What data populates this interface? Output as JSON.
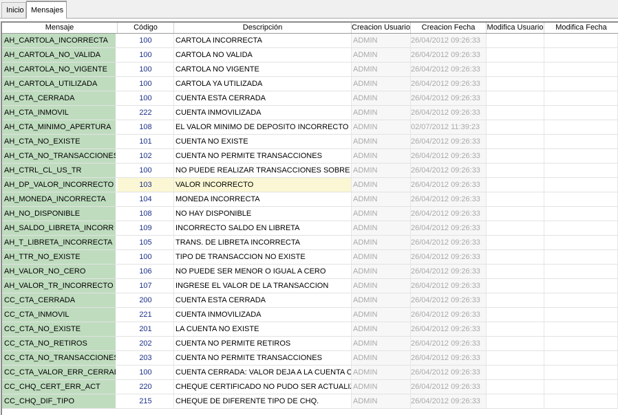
{
  "tabs": [
    {
      "label": "Inicio"
    },
    {
      "label": "Mensajes"
    }
  ],
  "grid": {
    "columns": [
      "Mensaje",
      "Código",
      "Descripción",
      "Creacion Usuario",
      "Creacion Fecha",
      "Modifica Usuario",
      "Modifica Fecha"
    ],
    "rows": [
      {
        "mensaje": "AH_CARTOLA_INCORRECTA",
        "codigo": "100",
        "descripcion": "CARTOLA INCORRECTA",
        "creacion_usuario": "ADMIN",
        "creacion_fecha": "26/04/2012 09:26:33",
        "modifica_usuario": "",
        "modifica_fecha": ""
      },
      {
        "mensaje": "AH_CARTOLA_NO_VALIDA",
        "codigo": "100",
        "descripcion": "CARTOLA NO VALIDA",
        "creacion_usuario": "ADMIN",
        "creacion_fecha": "26/04/2012 09:26:33",
        "modifica_usuario": "",
        "modifica_fecha": ""
      },
      {
        "mensaje": "AH_CARTOLA_NO_VIGENTE",
        "codigo": "100",
        "descripcion": "CARTOLA NO VIGENTE",
        "creacion_usuario": "ADMIN",
        "creacion_fecha": "26/04/2012 09:26:33",
        "modifica_usuario": "",
        "modifica_fecha": ""
      },
      {
        "mensaje": "AH_CARTOLA_UTILIZADA",
        "codigo": "100",
        "descripcion": "CARTOLA YA UTILIZADA",
        "creacion_usuario": "ADMIN",
        "creacion_fecha": "26/04/2012 09:26:33",
        "modifica_usuario": "",
        "modifica_fecha": ""
      },
      {
        "mensaje": "AH_CTA_CERRADA",
        "codigo": "100",
        "descripcion": "CUENTA ESTA CERRADA",
        "creacion_usuario": "ADMIN",
        "creacion_fecha": "26/04/2012 09:26:33",
        "modifica_usuario": "",
        "modifica_fecha": ""
      },
      {
        "mensaje": "AH_CTA_INMOVIL",
        "codigo": "222",
        "descripcion": "CUENTA INMOVILIZADA",
        "creacion_usuario": "ADMIN",
        "creacion_fecha": "26/04/2012 09:26:33",
        "modifica_usuario": "",
        "modifica_fecha": ""
      },
      {
        "mensaje": "AH_CTA_MINIMO_APERTURA",
        "codigo": "108",
        "descripcion": "EL VALOR MINIMO DE DEPOSITO INCORRECTO",
        "creacion_usuario": "ADMIN",
        "creacion_fecha": "02/07/2012 11:39:23",
        "modifica_usuario": "",
        "modifica_fecha": ""
      },
      {
        "mensaje": "AH_CTA_NO_EXISTE",
        "codigo": "101",
        "descripcion": "CUENTA NO EXISTE",
        "creacion_usuario": "ADMIN",
        "creacion_fecha": "26/04/2012 09:26:33",
        "modifica_usuario": "",
        "modifica_fecha": ""
      },
      {
        "mensaje": "AH_CTA_NO_TRANSACCIONES",
        "codigo": "102",
        "descripcion": "CUENTA NO PERMITE TRANSACCIONES",
        "creacion_usuario": "ADMIN",
        "creacion_fecha": "26/04/2012 09:26:33",
        "modifica_usuario": "",
        "modifica_fecha": ""
      },
      {
        "mensaje": "AH_CTRL_CL_US_TR",
        "codigo": "100",
        "descripcion": "NO PUEDE REALIZAR TRANSACCIONES SOBRE CUE",
        "creacion_usuario": "ADMIN",
        "creacion_fecha": "26/04/2012 09:26:33",
        "modifica_usuario": "",
        "modifica_fecha": ""
      },
      {
        "mensaje": "AH_DP_VALOR_INCORRECTO",
        "codigo": "103",
        "descripcion": "VALOR INCORRECTO",
        "creacion_usuario": "ADMIN",
        "creacion_fecha": "26/04/2012 09:26:33",
        "modifica_usuario": "",
        "modifica_fecha": "",
        "selected": true
      },
      {
        "mensaje": "AH_MONEDA_INCORRECTA",
        "codigo": "104",
        "descripcion": "MONEDA INCORRECTA",
        "creacion_usuario": "ADMIN",
        "creacion_fecha": "26/04/2012 09:26:33",
        "modifica_usuario": "",
        "modifica_fecha": ""
      },
      {
        "mensaje": "AH_NO_DISPONIBLE",
        "codigo": "108",
        "descripcion": "NO HAY DISPONIBLE",
        "creacion_usuario": "ADMIN",
        "creacion_fecha": "26/04/2012 09:26:33",
        "modifica_usuario": "",
        "modifica_fecha": ""
      },
      {
        "mensaje": "AH_SALDO_LIBRETA_INCORR",
        "codigo": "109",
        "descripcion": "INCORRECTO SALDO EN LIBRETA",
        "creacion_usuario": "ADMIN",
        "creacion_fecha": "26/04/2012 09:26:33",
        "modifica_usuario": "",
        "modifica_fecha": ""
      },
      {
        "mensaje": "AH_T_LIBRETA_INCORRECTA",
        "codigo": "105",
        "descripcion": "TRANS. DE LIBRETA INCORRECTA",
        "creacion_usuario": "ADMIN",
        "creacion_fecha": "26/04/2012 09:26:33",
        "modifica_usuario": "",
        "modifica_fecha": ""
      },
      {
        "mensaje": "AH_TTR_NO_EXISTE",
        "codigo": "100",
        "descripcion": "TIPO DE TRANSACCION NO EXISTE",
        "creacion_usuario": "ADMIN",
        "creacion_fecha": "26/04/2012 09:26:33",
        "modifica_usuario": "",
        "modifica_fecha": ""
      },
      {
        "mensaje": "AH_VALOR_NO_CERO",
        "codigo": "106",
        "descripcion": "NO PUEDE SER MENOR O IGUAL A CERO",
        "creacion_usuario": "ADMIN",
        "creacion_fecha": "26/04/2012 09:26:33",
        "modifica_usuario": "",
        "modifica_fecha": ""
      },
      {
        "mensaje": "AH_VALOR_TR_INCORRECTO",
        "codigo": "107",
        "descripcion": "INGRESE EL VALOR DE LA TRANSACCION",
        "creacion_usuario": "ADMIN",
        "creacion_fecha": "26/04/2012 09:26:33",
        "modifica_usuario": "",
        "modifica_fecha": ""
      },
      {
        "mensaje": "CC_CTA_CERRADA",
        "codigo": "200",
        "descripcion": "CUENTA ESTA CERRADA",
        "creacion_usuario": "ADMIN",
        "creacion_fecha": "26/04/2012 09:26:33",
        "modifica_usuario": "",
        "modifica_fecha": ""
      },
      {
        "mensaje": "CC_CTA_INMOVIL",
        "codigo": "221",
        "descripcion": "CUENTA INMOVILIZADA",
        "creacion_usuario": "ADMIN",
        "creacion_fecha": "26/04/2012 09:26:33",
        "modifica_usuario": "",
        "modifica_fecha": ""
      },
      {
        "mensaje": "CC_CTA_NO_EXISTE",
        "codigo": "201",
        "descripcion": "LA CUENTA NO EXISTE",
        "creacion_usuario": "ADMIN",
        "creacion_fecha": "26/04/2012 09:26:33",
        "modifica_usuario": "",
        "modifica_fecha": ""
      },
      {
        "mensaje": "CC_CTA_NO_RETIROS",
        "codigo": "202",
        "descripcion": "CUENTA NO PERMITE RETIROS",
        "creacion_usuario": "ADMIN",
        "creacion_fecha": "26/04/2012 09:26:33",
        "modifica_usuario": "",
        "modifica_fecha": ""
      },
      {
        "mensaje": "CC_CTA_NO_TRANSACCIONES",
        "codigo": "203",
        "descripcion": "CUENTA NO PERMITE TRANSACCIONES",
        "creacion_usuario": "ADMIN",
        "creacion_fecha": "26/04/2012 09:26:33",
        "modifica_usuario": "",
        "modifica_fecha": ""
      },
      {
        "mensaje": "CC_CTA_VALOR_ERR_CERRADA",
        "codigo": "100",
        "descripcion": "CUENTA CERRADA: VALOR DEJA A LA CUENTA CERR",
        "creacion_usuario": "ADMIN",
        "creacion_fecha": "26/04/2012 09:26:33",
        "modifica_usuario": "",
        "modifica_fecha": ""
      },
      {
        "mensaje": "CC_CHQ_CERT_ERR_ACT",
        "codigo": "220",
        "descripcion": "CHEQUE CERTIFICADO NO PUDO SER ACTUALIZADO",
        "creacion_usuario": "ADMIN",
        "creacion_fecha": "26/04/2012 09:26:33",
        "modifica_usuario": "",
        "modifica_fecha": ""
      },
      {
        "mensaje": "CC_CHQ_DIF_TIPO",
        "codigo": "215",
        "descripcion": "CHEQUE DE DIFERENTE TIPO DE CHQ.",
        "creacion_usuario": "ADMIN",
        "creacion_fecha": "26/04/2012 09:26:33",
        "modifica_usuario": "",
        "modifica_fecha": ""
      }
    ]
  }
}
